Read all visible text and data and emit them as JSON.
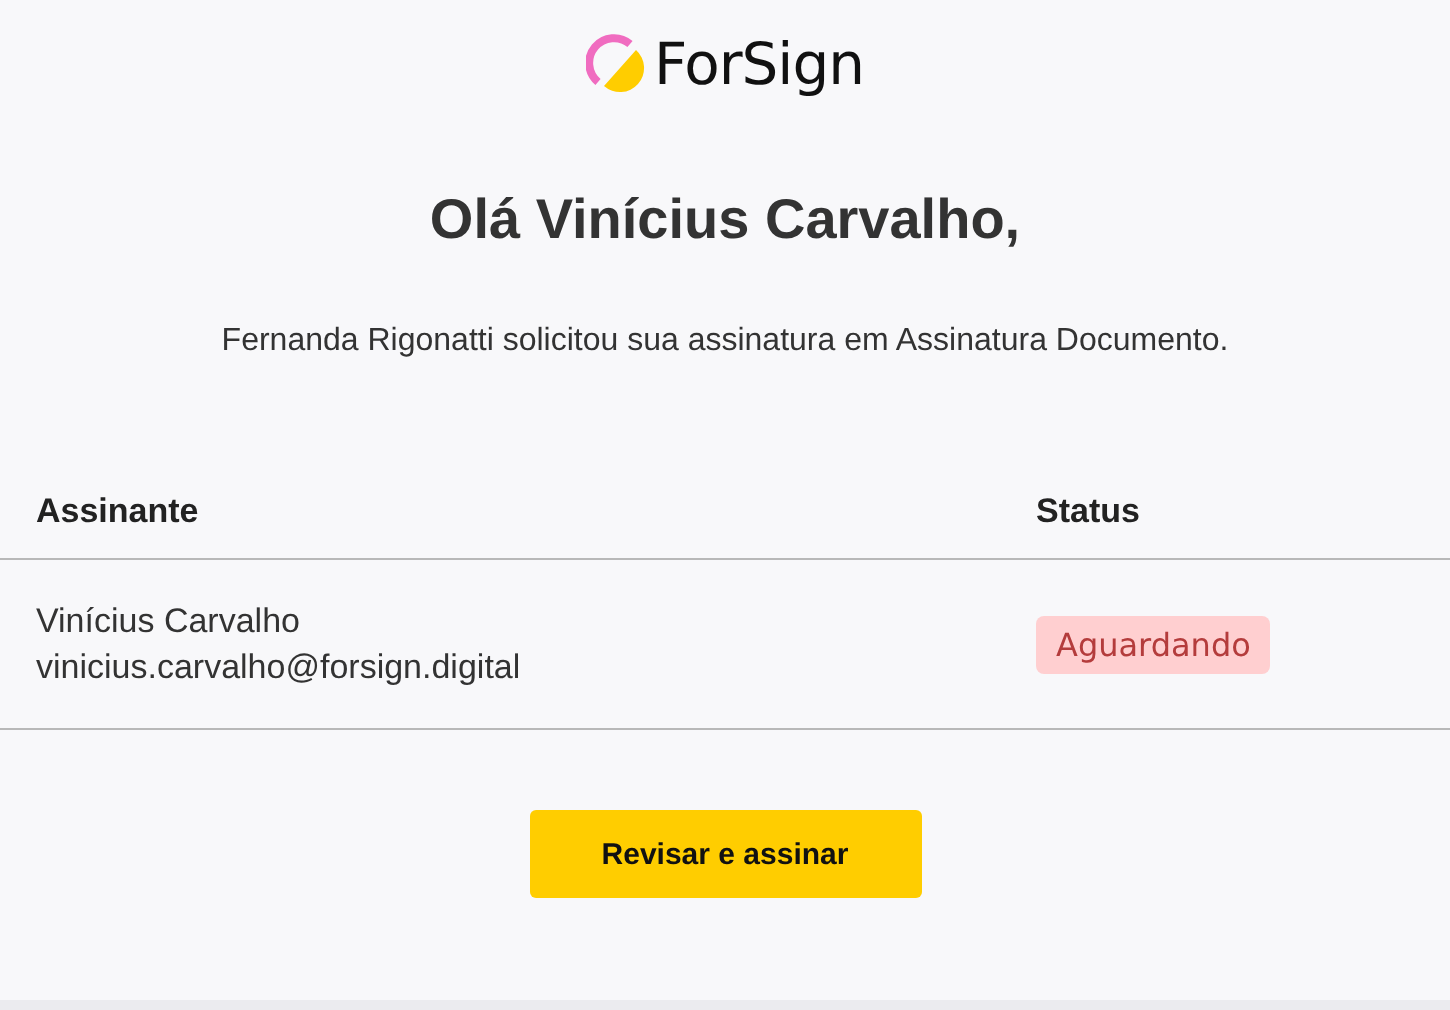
{
  "logo": {
    "text": "ForSign"
  },
  "greeting": "Olá Vinícius Carvalho,",
  "message": "Fernanda Rigonatti solicitou sua assinatura em Assinatura Documento.",
  "table": {
    "columns": [
      "Assinante",
      "Status"
    ],
    "rows": [
      {
        "name": "Vinícius Carvalho",
        "email": "vinicius.carvalho@forsign.digital",
        "status": "Aguardando",
        "color": "#ffcfd0"
      }
    ]
  },
  "button": "Revisar e assinar"
}
